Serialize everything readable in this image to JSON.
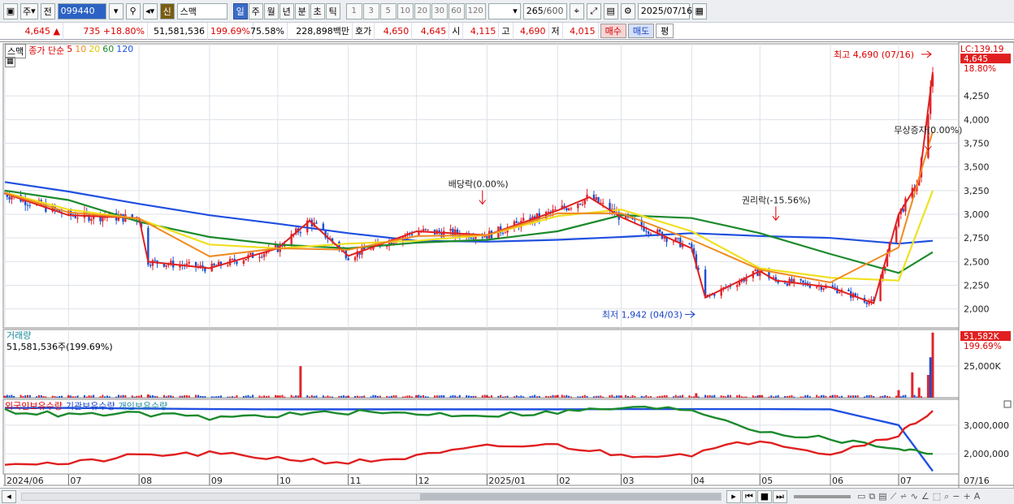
{
  "toolbar": {
    "type_label": "주",
    "prev_label": "전",
    "code": "099440",
    "sin_label": "신",
    "name": "스맥",
    "periods": [
      "일",
      "주",
      "월",
      "년",
      "분",
      "초",
      "틱"
    ],
    "period_selected": "일",
    "intervals": [
      "1",
      "3",
      "5",
      "10",
      "20",
      "30",
      "60",
      "120"
    ],
    "count": "265",
    "count_total": "/600",
    "date": "2025/07/16"
  },
  "info": {
    "price": "4,645",
    "arrow": "▲",
    "change": "735",
    "change_pct": "+18.80%",
    "volume": "51,581,536",
    "vol_ratio": "199.69%",
    "ratio2": "75.58%",
    "amount": "228,898백만",
    "hoga_label": "호가",
    "hoga1": "4,650",
    "hoga2": "4,645",
    "open_label": "시",
    "open": "4,115",
    "high_label": "고",
    "high": "4,690",
    "low_label": "저",
    "low": "4,015",
    "buy_label": "매수",
    "sell_label": "매도",
    "eval_label": "평"
  },
  "legend": {
    "name": "스맥",
    "ma_title": "종가 단순",
    "ma5": "5",
    "ma10": "10",
    "ma20": "20",
    "ma60": "60",
    "ma120": "120",
    "volume_title": "거래량",
    "volume_value": "51,581,536주(199.69%)",
    "holdings_foreign": "외국인보유수량",
    "holdings_inst": "기관보유수량",
    "holdings_indiv": "개인보유수량"
  },
  "colors": {
    "up": "#e0242c",
    "down": "#1a50d0",
    "ma5": "#e02020",
    "ma10": "#f08a20",
    "ma20": "#f0e020",
    "ma60": "#1c8a2c",
    "ma120": "#2050e0",
    "foreign": "#2050e0",
    "inst": "#1c8a2c",
    "indiv": "#e02020",
    "grid": "#dde1e8"
  },
  "chart_data": [
    {
      "type": "candlestick",
      "title": "스맥",
      "x_tick_labels": [
        "2024/06",
        "07",
        "08",
        "09",
        "10",
        "11",
        "12",
        "2025/01",
        "02",
        "03",
        "04",
        "05",
        "06",
        "07",
        "07/16"
      ],
      "y_ticks": [
        2000,
        2250,
        2500,
        2750,
        3000,
        3250,
        3500,
        3750,
        4000,
        4250
      ],
      "ylim": [
        1800,
        4800
      ],
      "last_price": "4,645",
      "last_change_pct": "18.80%",
      "lc_label": "LC:139.19",
      "high_annotation": "최고 4,690 (07/16)",
      "low_annotation": "최저 1,942 (04/03)",
      "events": [
        {
          "label": "배당락(0.00%)",
          "x": "2024-12-30"
        },
        {
          "label": "권리락(-15.56%)",
          "x": "2025-05-08"
        },
        {
          "label": "무상증자(0.00%)",
          "x": "2025-07-14"
        }
      ],
      "series": [
        {
          "name": "5",
          "x": [
            "2024-06-03",
            "2024-07-01",
            "2024-08-01",
            "2024-08-05",
            "2024-09-01",
            "2024-10-01",
            "2024-10-15",
            "2024-11-01",
            "2024-12-01",
            "2025-01-01",
            "2025-02-01",
            "2025-02-15",
            "2025-03-01",
            "2025-04-01",
            "2025-04-07",
            "2025-05-01",
            "2025-05-08",
            "2025-06-01",
            "2025-06-20",
            "2025-07-01",
            "2025-07-10",
            "2025-07-16"
          ],
          "values": [
            3220,
            2990,
            2960,
            2500,
            2430,
            2640,
            2930,
            2560,
            2820,
            2780,
            3040,
            3180,
            2970,
            2640,
            2120,
            2400,
            2300,
            2230,
            2060,
            3000,
            3350,
            4500
          ]
        },
        {
          "name": "20",
          "x": [
            "2024-06-03",
            "2024-07-01",
            "2024-08-01",
            "2024-09-01",
            "2024-10-01",
            "2024-11-01",
            "2024-12-01",
            "2025-01-01",
            "2025-02-01",
            "2025-03-01",
            "2025-04-01",
            "2025-05-01",
            "2025-06-01",
            "2025-07-01",
            "2025-07-16"
          ],
          "values": [
            3230,
            3050,
            2950,
            2680,
            2640,
            2690,
            2720,
            2780,
            2980,
            3050,
            2820,
            2430,
            2330,
            2300,
            3250
          ]
        },
        {
          "name": "60",
          "x": [
            "2024-06-03",
            "2024-07-01",
            "2024-08-01",
            "2024-09-01",
            "2024-10-01",
            "2024-11-01",
            "2024-12-01",
            "2025-01-01",
            "2025-02-01",
            "2025-03-01",
            "2025-04-01",
            "2025-05-01",
            "2025-06-01",
            "2025-07-01",
            "2025-07-16"
          ],
          "values": [
            3250,
            3150,
            2920,
            2760,
            2680,
            2640,
            2700,
            2730,
            2820,
            2990,
            2960,
            2800,
            2580,
            2380,
            2600
          ]
        },
        {
          "name": "120",
          "x": [
            "2024-06-03",
            "2024-07-01",
            "2024-08-01",
            "2024-09-01",
            "2024-10-01",
            "2024-11-01",
            "2024-12-01",
            "2025-01-01",
            "2025-02-01",
            "2025-03-01",
            "2025-04-01",
            "2025-05-01",
            "2025-06-01",
            "2025-07-01",
            "2025-07-16"
          ],
          "values": [
            3340,
            3240,
            3110,
            2990,
            2900,
            2800,
            2720,
            2710,
            2730,
            2760,
            2800,
            2770,
            2750,
            2690,
            2720
          ]
        }
      ]
    },
    {
      "type": "bar",
      "title": "거래량",
      "y_tick": "25,000K",
      "last_value": "51,582K",
      "last_pct": "199.69%",
      "x": [
        "2024-06-03",
        "2024-07-01",
        "2024-08-05",
        "2024-10-01",
        "2024-10-11",
        "2024-11-01",
        "2024-12-01",
        "2025-01-01",
        "2025-02-01",
        "2025-03-01",
        "2025-04-03",
        "2025-05-01",
        "2025-06-01",
        "2025-07-01",
        "2025-07-07",
        "2025-07-10",
        "2025-07-14",
        "2025-07-15",
        "2025-07-16"
      ],
      "values": [
        1500,
        1200,
        2500,
        1800,
        25000,
        1600,
        2000,
        1500,
        2200,
        1700,
        3500,
        2100,
        1500,
        6000,
        20000,
        8000,
        18000,
        32000,
        51582
      ]
    },
    {
      "type": "line",
      "y_ticks": [
        "2,000,000",
        "3,000,000"
      ],
      "series": [
        {
          "name": "외국인보유수량",
          "values": [
            3600000,
            3600000,
            3580000,
            3560000,
            3550000,
            3550000,
            3550000,
            3550000,
            3550000,
            3560000,
            3560000,
            3560000,
            3550000,
            3000000,
            1400000
          ]
        },
        {
          "name": "기관보유수량",
          "values": [
            3500000,
            3350000,
            3400000,
            3250000,
            3350000,
            3450000,
            3400000,
            3350000,
            3450000,
            3600000,
            3550000,
            2800000,
            2500000,
            2200000,
            2000000
          ]
        },
        {
          "name": "개인보유수량",
          "values": [
            1700000,
            1650000,
            1950000,
            2000000,
            1850000,
            1700000,
            1900000,
            2250000,
            2300000,
            1950000,
            2000000,
            2500000,
            2000000,
            2700000,
            3500000
          ]
        }
      ],
      "x_tick_labels": [
        "2024/06",
        "07",
        "08",
        "09",
        "10",
        "11",
        "12",
        "2025/01",
        "02",
        "03",
        "04",
        "05",
        "06",
        "07",
        "07/16"
      ]
    }
  ],
  "bottom": {
    "nav_buttons": [
      "◀",
      "▶",
      "▶|",
      "◀◀",
      "■",
      "▶▶"
    ]
  }
}
